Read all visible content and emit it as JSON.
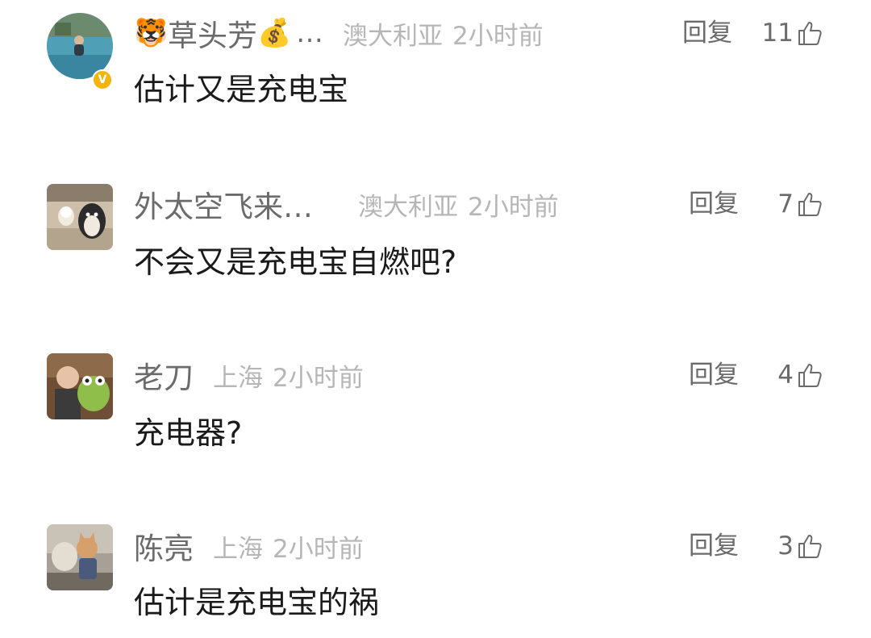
{
  "comments": [
    {
      "username": "草头芳",
      "username_prefix_emoji": "🐯",
      "username_suffix_emoji": "💰",
      "ellipsis": "…",
      "location": "澳大利亚",
      "time": "2小时前",
      "reply_label": "回复",
      "likes": "11",
      "text": "估计又是充电宝",
      "avatar_icon": "pool-photo-avatar",
      "verified_badge": "V",
      "verified_color": "#f5b40b"
    },
    {
      "username": "外太空飞来…",
      "location": "澳大利亚",
      "time": "2小时前",
      "reply_label": "回复",
      "likes": "7",
      "text": "不会又是充电宝自燃吧?",
      "avatar_icon": "penguin-toy-avatar"
    },
    {
      "username": "老刀",
      "location": "上海",
      "time": "2小时前",
      "reply_label": "回复",
      "likes": "4",
      "text": "充电器?",
      "avatar_icon": "old-man-frog-avatar"
    },
    {
      "username": "陈亮",
      "location": "上海",
      "time": "2小时前",
      "reply_label": "回复",
      "likes": "3",
      "text": "估计是充电宝的祸",
      "avatar_icon": "cat-traveler-avatar"
    }
  ],
  "colors": {
    "username": "#6b6b6b",
    "meta": "#b6b6b6",
    "content": "#1a1a1a",
    "background": "#ffffff"
  }
}
